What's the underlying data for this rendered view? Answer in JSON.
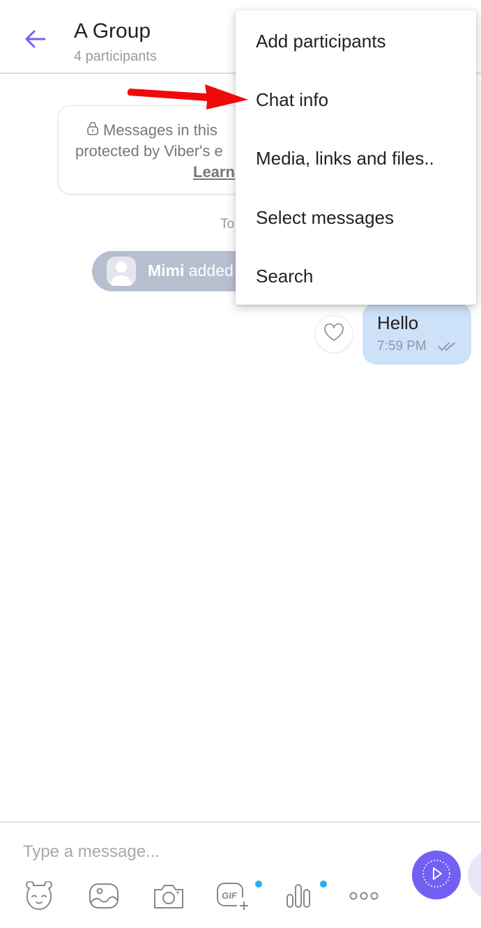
{
  "header": {
    "back_icon": "arrow-left-icon",
    "title": "A Group",
    "subtitle": "4 participants"
  },
  "chat": {
    "e2e_notice": {
      "icon": "lock-icon",
      "line1": "Messages in this",
      "line2": "protected by Viber's e",
      "link": "Learn"
    },
    "date_separator": "To",
    "system_message": {
      "avatar_icon": "avatar-placeholder-icon",
      "actor": "Mimi",
      "text": "added"
    },
    "messages": [
      {
        "text": "Hello",
        "time": "7:59 PM",
        "status_icon": "double-check-icon",
        "outgoing": true,
        "like_icon": "heart-icon"
      }
    ]
  },
  "menu": {
    "items": [
      {
        "label": "Add participants"
      },
      {
        "label": "Chat info"
      },
      {
        "label": "Media, links and files.."
      },
      {
        "label": "Select messages"
      },
      {
        "label": "Search"
      }
    ]
  },
  "composer": {
    "placeholder": "Type a message...",
    "value": "",
    "tools": [
      {
        "name": "sticker",
        "icon": "sticker-bear-icon",
        "badge": false
      },
      {
        "name": "gallery",
        "icon": "gallery-icon",
        "badge": false
      },
      {
        "name": "camera",
        "icon": "camera-icon",
        "badge": false
      },
      {
        "name": "gif",
        "icon": "gif-plus-icon",
        "badge": true
      },
      {
        "name": "poll",
        "icon": "poll-bars-icon",
        "badge": true
      },
      {
        "name": "more",
        "icon": "more-dots-icon",
        "badge": false
      }
    ],
    "send_icon": "video-message-icon"
  },
  "colors": {
    "accent": "#7360f2",
    "bubble_outgoing": "#cde1f8",
    "system_pill": "#b6bfd0",
    "badge_dot": "#1fb3e8",
    "annotation_arrow": "#ee0a0a"
  }
}
